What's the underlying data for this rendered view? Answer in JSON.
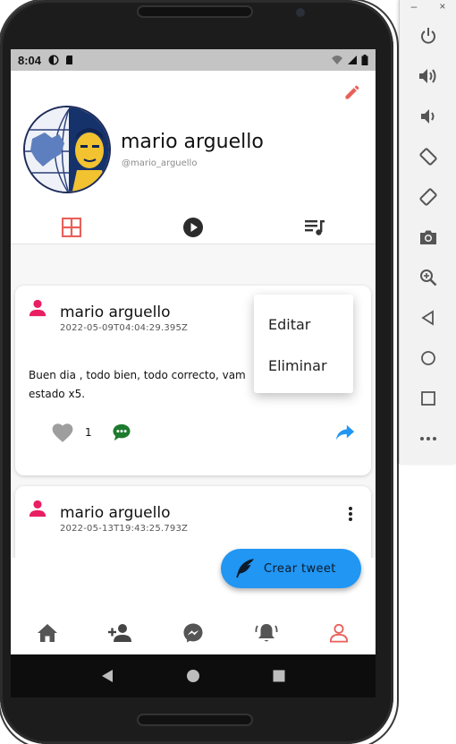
{
  "status_bar": {
    "time": "8:04"
  },
  "profile": {
    "name": "mario arguello",
    "handle": "@mario_arguello"
  },
  "tabs": [
    {
      "icon": "grid-icon",
      "active": true
    },
    {
      "icon": "play-circle-icon",
      "active": false
    },
    {
      "icon": "playlist-icon",
      "active": false
    }
  ],
  "tweets": [
    {
      "author": "mario arguello",
      "date": "2022-05-09T04:04:29.395Z",
      "body": "Buen dia , todo bien, todo correcto, vam",
      "body_line2": "estado x5.",
      "likes": "1"
    },
    {
      "author": "mario arguello",
      "date": "2022-05-13T19:43:25.793Z"
    }
  ],
  "context_menu": {
    "edit_label": "Editar",
    "delete_label": "Eliminar"
  },
  "fab": {
    "label": "Crear tweet"
  },
  "bottom_nav": [
    {
      "icon": "home-icon"
    },
    {
      "icon": "add-person-icon"
    },
    {
      "icon": "messenger-icon"
    },
    {
      "icon": "notifications-icon"
    },
    {
      "icon": "profile-icon",
      "active": true
    }
  ],
  "colors": {
    "accent": "#e8605a",
    "pink": "#e91e63",
    "fab": "#2196f3",
    "comment": "#1e7a2e",
    "share": "#2196f3",
    "like": "#9e9e9e"
  },
  "emulator_panel": {
    "minimize": "–",
    "close": "×",
    "buttons": [
      "power-icon",
      "volume-up-icon",
      "volume-down-icon",
      "rotate-left-icon",
      "rotate-right-icon",
      "camera-icon",
      "zoom-icon",
      "back-icon",
      "home-circle-icon",
      "overview-icon",
      "more-icon"
    ]
  }
}
